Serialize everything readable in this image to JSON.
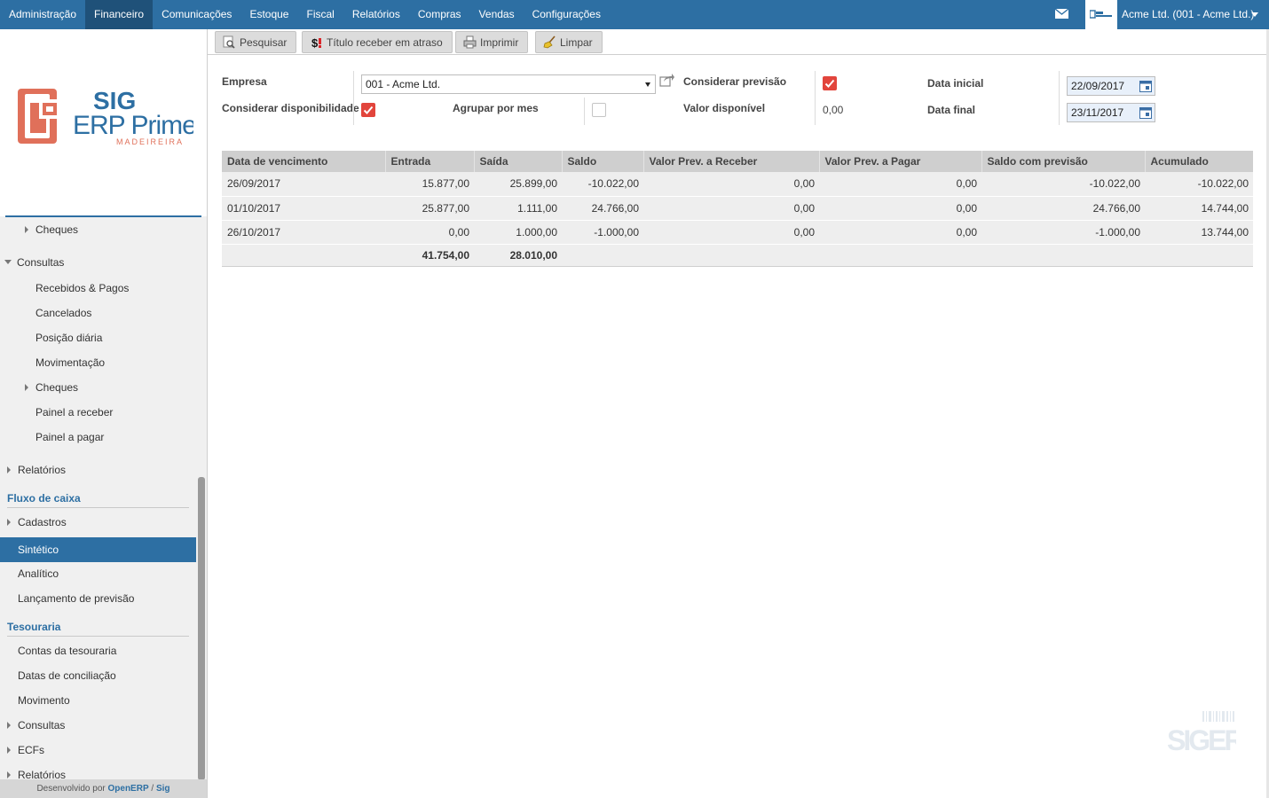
{
  "topbar": {
    "menu": [
      {
        "label": "Administração",
        "name": "menu-administracao"
      },
      {
        "label": "Financeiro",
        "name": "menu-financeiro",
        "active": true
      },
      {
        "label": "Comunicações",
        "name": "menu-comunicacoes"
      },
      {
        "label": "Estoque",
        "name": "menu-estoque"
      },
      {
        "label": "Fiscal",
        "name": "menu-fiscal"
      },
      {
        "label": "Relatórios",
        "name": "menu-relatorios"
      },
      {
        "label": "Compras",
        "name": "menu-compras"
      },
      {
        "label": "Vendas",
        "name": "menu-vendas"
      },
      {
        "label": "Configurações",
        "name": "menu-configuracoes"
      }
    ],
    "company": "Acme Ltd. (001 - Acme Ltd.)",
    "accent": "#2d6fa3"
  },
  "logo": {
    "line1": "SIG",
    "line2": "ERP Prime",
    "line3": "MADEIREIRA"
  },
  "sidebar": {
    "items": [
      {
        "label": "Cheques",
        "name": "sidebar-item-cheques"
      },
      {
        "label": "Consultas",
        "name": "sidebar-item-consultas"
      },
      {
        "label": "Recebidos & Pagos",
        "name": "sidebar-item-recebidos-pagos"
      },
      {
        "label": "Cancelados",
        "name": "sidebar-item-cancelados"
      },
      {
        "label": "Posição diária",
        "name": "sidebar-item-posicao-diaria"
      },
      {
        "label": "Movimentação",
        "name": "sidebar-item-movimentacao"
      },
      {
        "label": "Cheques",
        "name": "sidebar-item-cheques-2"
      },
      {
        "label": "Painel a receber",
        "name": "sidebar-item-painel-receber"
      },
      {
        "label": "Painel a pagar",
        "name": "sidebar-item-painel-pagar"
      },
      {
        "label": "Relatórios",
        "name": "sidebar-item-relatorios"
      },
      {
        "label": "Cadastros",
        "name": "sidebar-item-cadastros"
      },
      {
        "label": "Sintético",
        "name": "sidebar-item-sintetico"
      },
      {
        "label": "Analítico",
        "name": "sidebar-item-analitico"
      },
      {
        "label": "Lançamento de previsão",
        "name": "sidebar-item-lancamento-previsao"
      },
      {
        "label": "Contas da tesouraria",
        "name": "sidebar-item-contas-tesouraria"
      },
      {
        "label": "Datas de conciliação",
        "name": "sidebar-item-datas-conciliacao"
      },
      {
        "label": "Movimento",
        "name": "sidebar-item-movimento"
      },
      {
        "label": "Consultas",
        "name": "sidebar-item-consultas-2"
      },
      {
        "label": "ECFs",
        "name": "sidebar-item-ecfs"
      },
      {
        "label": "Relatórios",
        "name": "sidebar-item-relatorios-2"
      }
    ],
    "sections": {
      "fluxo": "Fluxo de caixa",
      "tesouraria": "Tesouraria"
    },
    "footer": {
      "prefix": "Desenvolvido por",
      "openerp": "OpenERP",
      "sep": "/",
      "sig": "Sig"
    }
  },
  "toolbar": {
    "search": "Pesquisar",
    "overdue": "Título receber em atraso",
    "print": "Imprimir",
    "clear": "Limpar"
  },
  "form": {
    "empresa_label": "Empresa",
    "empresa_value": "001 - Acme Ltd.",
    "considerar_previsao_label": "Considerar previsão",
    "considerar_previsao": true,
    "data_inicial_label": "Data inicial",
    "data_inicial": "22/09/2017",
    "considerar_disponibilidade_label": "Considerar disponibilidade",
    "considerar_disponibilidade": true,
    "agrupar_label": "Agrupar por mes",
    "agrupar": false,
    "valor_disponivel_label": "Valor disponível",
    "valor_disponivel": "0,00",
    "data_final_label": "Data final",
    "data_final": "23/11/2017"
  },
  "table": {
    "headers": [
      "Data de vencimento",
      "Entrada",
      "Saída",
      "Saldo",
      "Valor Prev. a Receber",
      "Valor Prev. a Pagar",
      "Saldo com previsão",
      "Acumulado"
    ],
    "rows": [
      [
        "26/09/2017",
        "15.877,00",
        "25.899,00",
        "-10.022,00",
        "0,00",
        "0,00",
        "-10.022,00",
        "-10.022,00"
      ],
      [
        "01/10/2017",
        "25.877,00",
        "1.111,00",
        "24.766,00",
        "0,00",
        "0,00",
        "24.766,00",
        "14.744,00"
      ],
      [
        "26/10/2017",
        "0,00",
        "1.000,00",
        "-1.000,00",
        "0,00",
        "0,00",
        "-1.000,00",
        "13.744,00"
      ]
    ],
    "totals": [
      "",
      "41.754,00",
      "28.010,00",
      "",
      "",
      "",
      "",
      ""
    ]
  },
  "watermark": "SIGERP"
}
